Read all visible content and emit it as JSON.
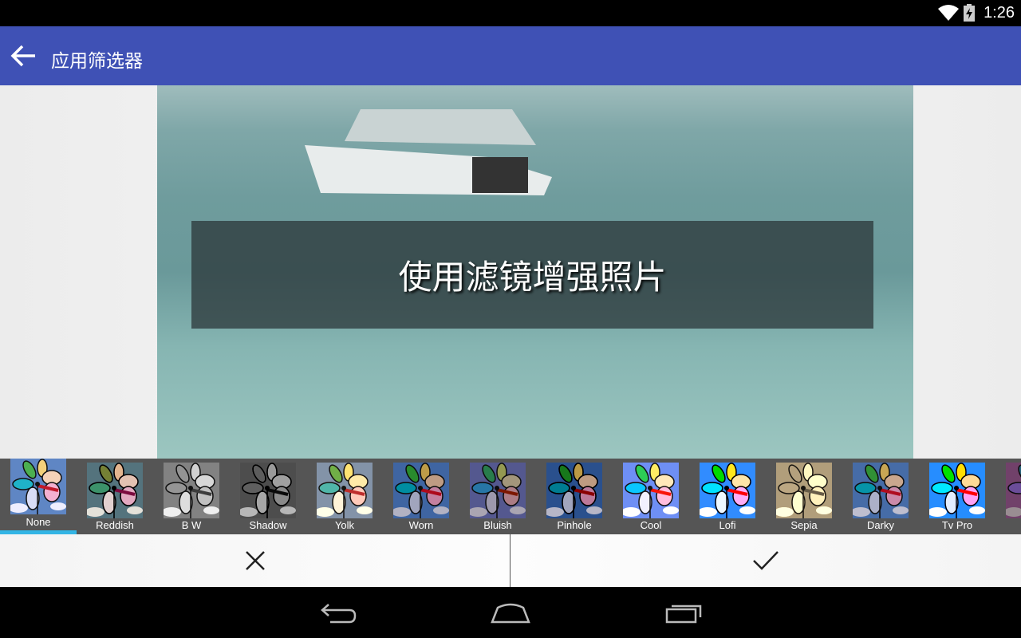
{
  "status_bar": {
    "time": "1:26",
    "icons": [
      "wifi-icon",
      "battery-charging-icon"
    ]
  },
  "app_bar": {
    "title": "应用筛选器",
    "back_icon": "arrow-left-icon",
    "color": "#3F51B5"
  },
  "preview": {
    "caption": "使用滤镜增强照片"
  },
  "filters": {
    "selected": "None",
    "accent": "#33b5e5",
    "items": [
      {
        "label": "None"
      },
      {
        "label": "Reddish"
      },
      {
        "label": "B W"
      },
      {
        "label": "Shadow"
      },
      {
        "label": "Yolk"
      },
      {
        "label": "Worn"
      },
      {
        "label": "Bluish"
      },
      {
        "label": "Pinhole"
      },
      {
        "label": "Cool"
      },
      {
        "label": "Lofi"
      },
      {
        "label": "Sepia"
      },
      {
        "label": "Darky"
      },
      {
        "label": "Tv Pro"
      },
      {
        "label": ""
      }
    ]
  },
  "actions": {
    "cancel_icon": "close-icon",
    "confirm_icon": "check-icon"
  },
  "nav_bar": {
    "icons": [
      "back-icon",
      "home-icon",
      "recents-icon"
    ]
  }
}
